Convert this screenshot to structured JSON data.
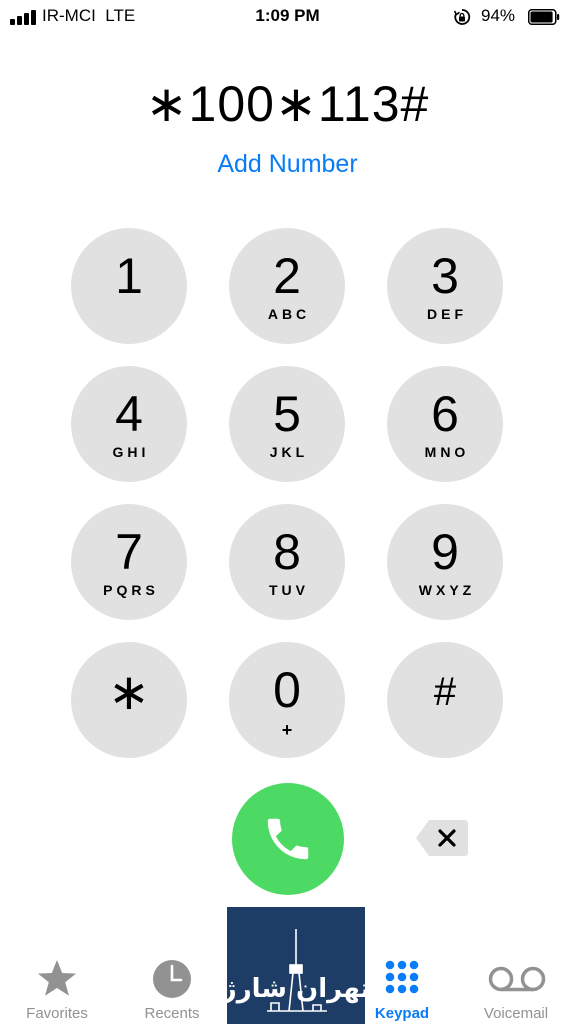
{
  "status_bar": {
    "carrier": "IR-MCI",
    "network": "LTE",
    "time": "1:09 PM",
    "battery_percent": "94%",
    "battery_level": 0.94
  },
  "dialer": {
    "number": "∗100∗113#",
    "add_number_label": "Add Number"
  },
  "keys": [
    {
      "digit": "1",
      "letters": ""
    },
    {
      "digit": "2",
      "letters": "ABC"
    },
    {
      "digit": "3",
      "letters": "DEF"
    },
    {
      "digit": "4",
      "letters": "GHI"
    },
    {
      "digit": "5",
      "letters": "JKL"
    },
    {
      "digit": "6",
      "letters": "MNO"
    },
    {
      "digit": "7",
      "letters": "PQRS"
    },
    {
      "digit": "8",
      "letters": "TUV"
    },
    {
      "digit": "9",
      "letters": "WXYZ"
    },
    {
      "digit": "∗",
      "letters": ""
    },
    {
      "digit": "0",
      "letters": "+"
    },
    {
      "digit": "#",
      "letters": ""
    }
  ],
  "call_button": {
    "icon": "phone-icon",
    "color": "#4cd964"
  },
  "delete_button": {
    "icon": "delete-backspace-icon"
  },
  "tabs": [
    {
      "label": "Favorites",
      "icon": "star-icon",
      "active": false
    },
    {
      "label": "Recents",
      "icon": "clock-icon",
      "active": false
    },
    {
      "label": "Keypad",
      "icon": "keypad-icon",
      "active": true
    },
    {
      "label": "Voicemail",
      "icon": "voicemail-icon",
      "active": false
    }
  ],
  "overlay_logo": {
    "text": "تهران شارژ",
    "icon": "milad-tower-logo"
  },
  "colors": {
    "accent": "#0a7cf5",
    "key_background": "#e1e1e1",
    "call_green": "#4cd964",
    "tab_inactive": "#929292",
    "logo_background": "#1d3d66"
  }
}
